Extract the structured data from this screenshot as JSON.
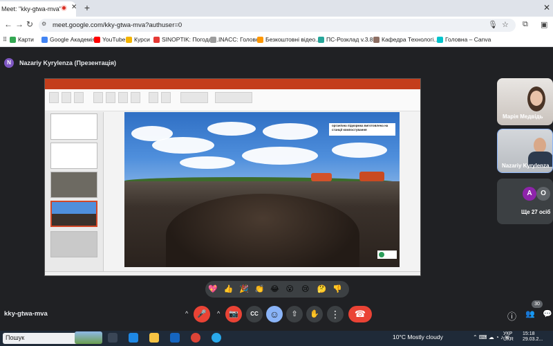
{
  "browser": {
    "tab_title": "Meet: \"kky-gtwa-mva\"",
    "tab_close": "✕",
    "new_tab": "+",
    "window_close": "✕",
    "url": "meet.google.com/kky-gtwa-mva?authuser=0",
    "back": "←",
    "forward": "→",
    "reload": "↻",
    "bookmarks": [
      {
        "label": "Карти",
        "color": "#34a853"
      },
      {
        "label": "Google Академія",
        "color": "#4285f4"
      },
      {
        "label": "YouTube",
        "color": "#ff0000"
      },
      {
        "label": "Курси",
        "color": "#f4b400"
      },
      {
        "label": "SINOPTIK: Погода в...",
        "color": "#e53935"
      },
      {
        "label": "INACC: Головна",
        "color": "#9e9e9e"
      },
      {
        "label": "Безкоштовні відео...",
        "color": "#ff9800"
      },
      {
        "label": "ПС-Розклад v.3.8.2",
        "color": "#26a69a"
      },
      {
        "label": "Кафедра Технологі...",
        "color": "#8d6e63"
      },
      {
        "label": "Головна – Canva",
        "color": "#00c4cc"
      }
    ]
  },
  "meet": {
    "presenter_initial": "N",
    "presenter_label": "Nazariy Kyrylenza (Презентація)",
    "slide_caption": "органічна підкормка виготовлена на станції компостування",
    "participants": {
      "tile1_name": "Марія Медвідь",
      "tile2_name": "Nazariy Kyrylenza",
      "others_label": "Ще 27 осіб",
      "avatar_a": "A",
      "avatar_o": "O"
    },
    "reactions": [
      "💖",
      "👍",
      "🎉",
      "👏",
      "😂",
      "😮",
      "😢",
      "🤔",
      "👎"
    ],
    "meeting_code": "kky-gtwa-mva",
    "participant_count": "30",
    "controls": {
      "mic": "🎤",
      "cam": "📷",
      "cc": "CC",
      "emoji": "☺",
      "present": "⇧",
      "hand": "✋",
      "more": "⋮",
      "leave": "☎",
      "chevron": "^",
      "info": "ⓘ",
      "people": "👥",
      "chat": "💬"
    },
    "colors": {
      "leave": "#ea4335",
      "muted": "#ea4335",
      "active": "#8ab4f8"
    }
  },
  "taskbar": {
    "search": "Пошук",
    "weather": "10°C  Mostly cloudy",
    "lang_top": "УКР",
    "lang_bottom": "UKR",
    "time": "15:18",
    "date": "29.03.2..."
  }
}
